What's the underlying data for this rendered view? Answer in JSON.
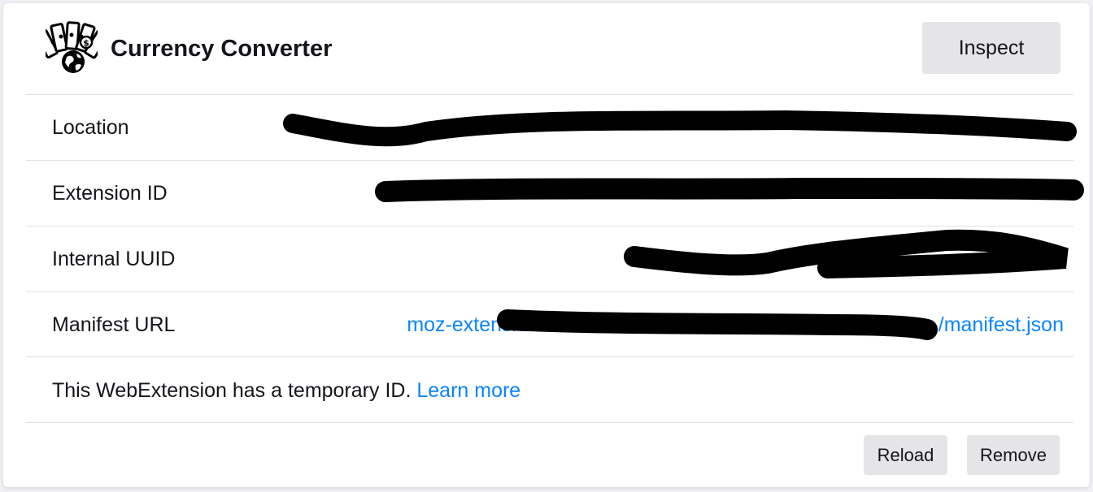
{
  "extension": {
    "name": "Currency Converter",
    "icon": "money-globe-icon"
  },
  "buttons": {
    "inspect": "Inspect",
    "reload": "Reload",
    "remove": "Remove"
  },
  "details": [
    {
      "label": "Location",
      "value": ""
    },
    {
      "label": "Extension ID",
      "value": ""
    },
    {
      "label": "Internal UUID",
      "value": ""
    },
    {
      "label": "Manifest URL",
      "value_prefix": "moz-extension://",
      "value_suffix": "/manifest.json"
    }
  ],
  "notice": {
    "text": "This WebExtension has a temporary ID.",
    "link": "Learn more"
  },
  "colors": {
    "link": "#0a84ff",
    "button_bg": "#e5e5e8",
    "redaction": "#000000"
  }
}
